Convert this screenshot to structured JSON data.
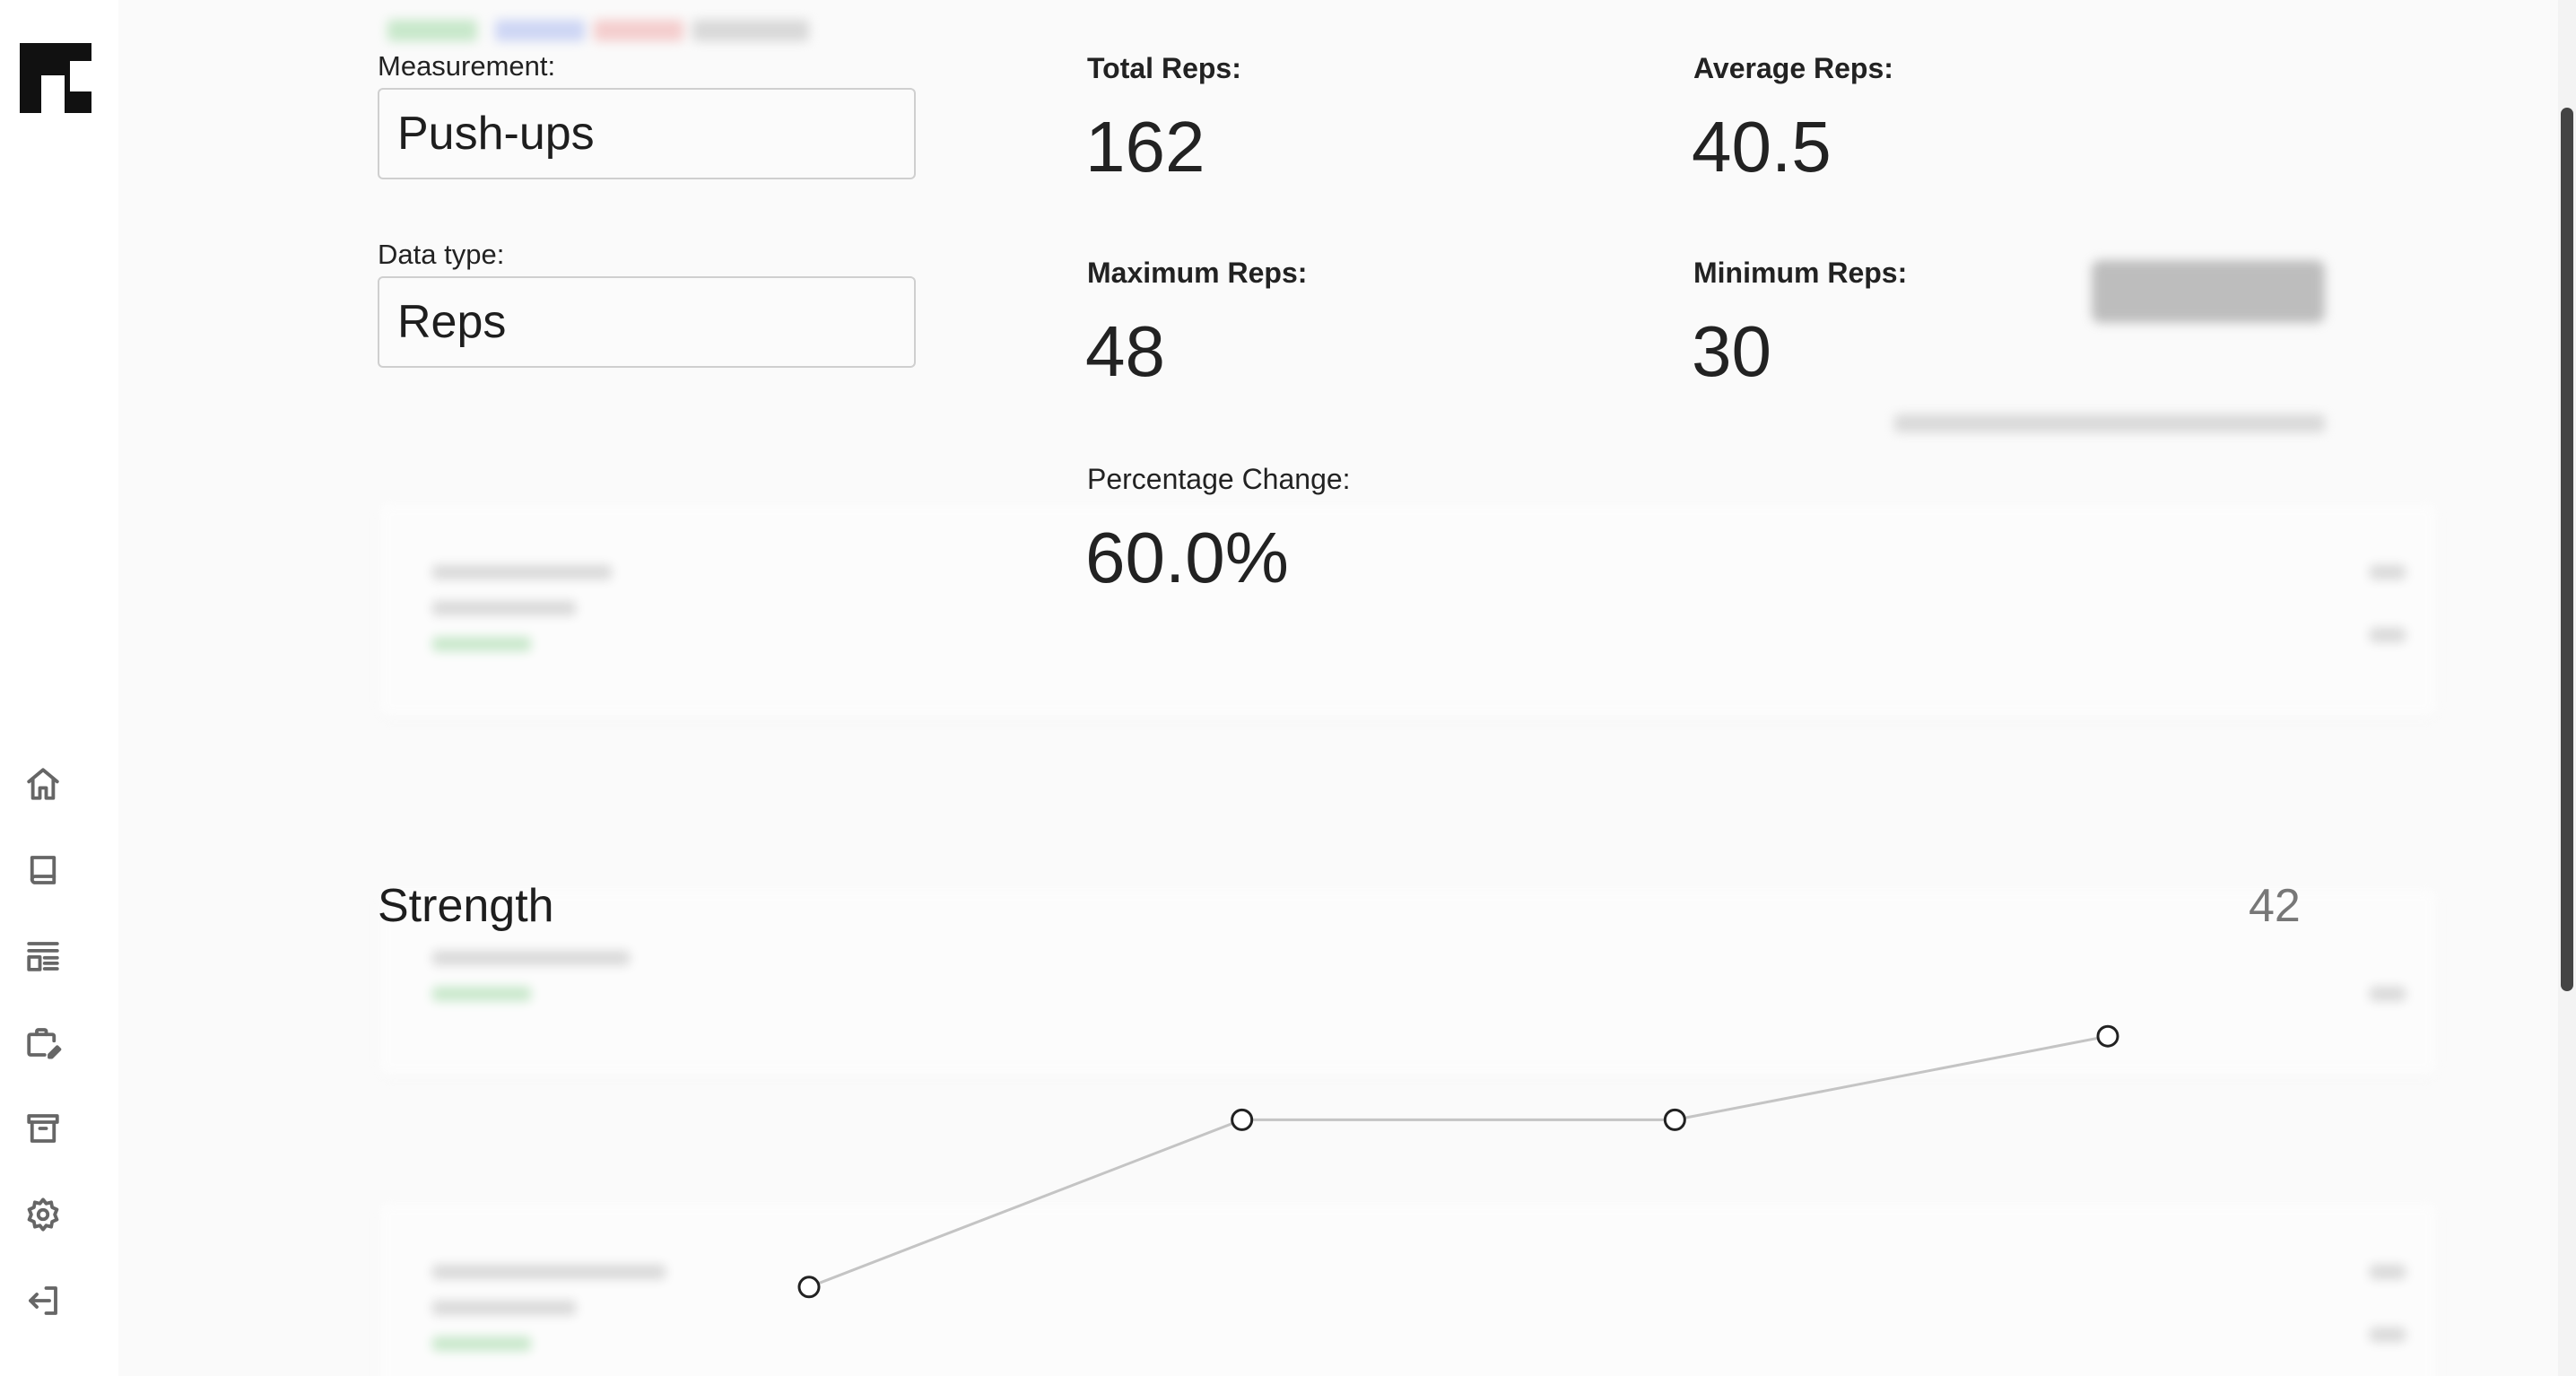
{
  "app": {
    "logo_icon": "brand-logo-icon"
  },
  "sidebar": {
    "items": [
      {
        "icon": "home-icon"
      },
      {
        "icon": "book-icon"
      },
      {
        "icon": "layout-list-icon"
      },
      {
        "icon": "briefcase-edit-icon"
      },
      {
        "icon": "archive-icon"
      },
      {
        "icon": "settings-icon"
      },
      {
        "icon": "logout-icon"
      }
    ]
  },
  "form": {
    "measurement_label": "Measurement:",
    "measurement_value": "Push-ups",
    "datatype_label": "Data type:",
    "datatype_value": "Reps"
  },
  "stats": {
    "total_label": "Total Reps:",
    "total_value": "162",
    "average_label": "Average Reps:",
    "average_value": "40.5",
    "max_label": "Maximum Reps:",
    "max_value": "48",
    "min_label": "Minimum Reps:",
    "min_value": "30",
    "pct_label": "Percentage Change:",
    "pct_value": "60.0%"
  },
  "section": {
    "title": "Strength",
    "count": "42"
  },
  "chart_data": {
    "type": "line",
    "title": "",
    "xlabel": "",
    "ylabel": "",
    "x": [
      1,
      2,
      3,
      4
    ],
    "series": [
      {
        "values": [
          30,
          42,
          42,
          48
        ]
      }
    ],
    "ylim": [
      24,
      54
    ],
    "grid": false,
    "line_color": "#c4c4c4",
    "marker_color": "#222222"
  }
}
